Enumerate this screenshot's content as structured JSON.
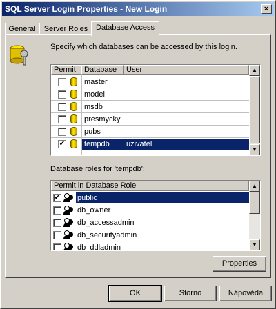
{
  "window": {
    "title": "SQL Server Login Properties - New Login",
    "close_glyph": "×"
  },
  "tabs": [
    {
      "label": "General"
    },
    {
      "label": "Server Roles"
    },
    {
      "label": "Database Access"
    }
  ],
  "instruction": "Specify which databases can be accessed by this login.",
  "db_table": {
    "headers": [
      "Permit",
      "Database",
      "User"
    ],
    "rows": [
      {
        "checked": false,
        "database": "master",
        "user": ""
      },
      {
        "checked": false,
        "database": "model",
        "user": ""
      },
      {
        "checked": false,
        "database": "msdb",
        "user": ""
      },
      {
        "checked": false,
        "database": "presmycky",
        "user": ""
      },
      {
        "checked": false,
        "database": "pubs",
        "user": ""
      },
      {
        "checked": true,
        "database": "tempdb",
        "user": "uzivatel",
        "selected": true
      }
    ]
  },
  "roles_label": "Database roles for 'tempdb':",
  "roles_table": {
    "header": "Permit in Database Role",
    "rows": [
      {
        "checked": true,
        "role": "public",
        "selected": true
      },
      {
        "checked": false,
        "role": "db_owner"
      },
      {
        "checked": false,
        "role": "db_accessadmin"
      },
      {
        "checked": false,
        "role": "db_securityadmin"
      },
      {
        "checked": false,
        "role": "db_ddladmin"
      }
    ]
  },
  "buttons": {
    "properties": "Properties",
    "ok": "OK",
    "cancel": "Storno",
    "help": "Nápověda"
  },
  "glyphs": {
    "check": "✔",
    "up": "▲",
    "down": "▼"
  },
  "colors": {
    "selection": "#0a246a",
    "face": "#d4d0c8"
  }
}
